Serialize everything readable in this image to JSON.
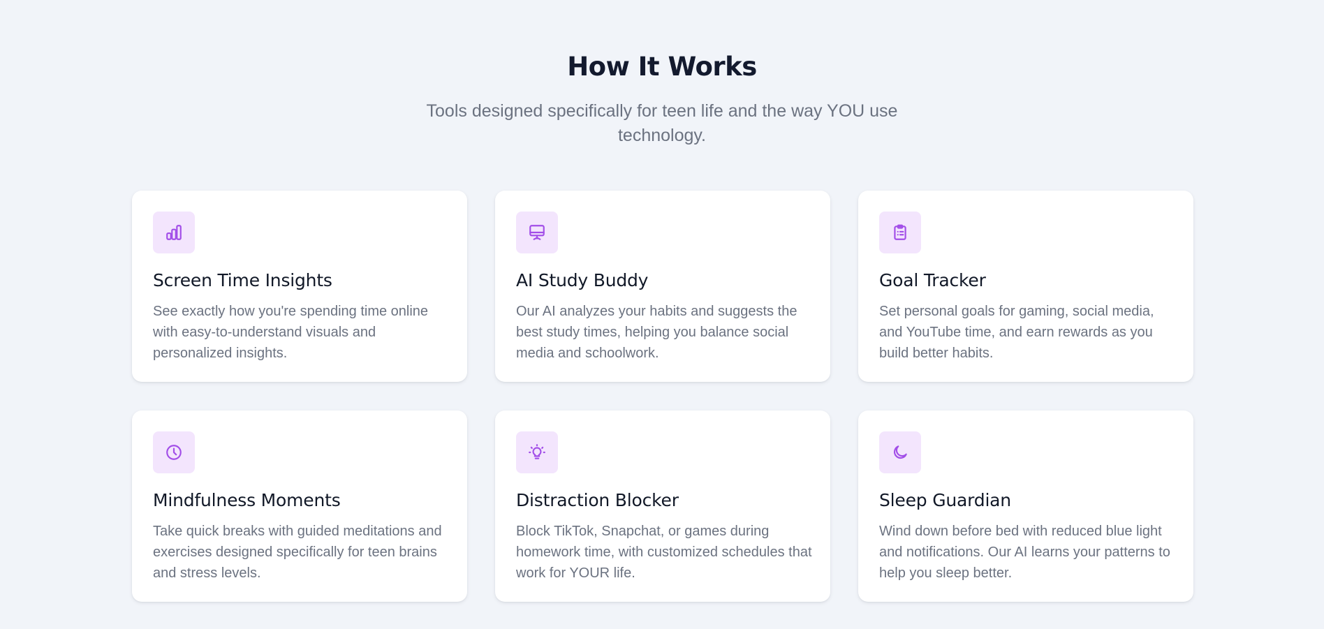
{
  "section": {
    "title": "How It Works",
    "subtitle": "Tools designed specifically for teen life and the way YOU use technology."
  },
  "features": [
    {
      "icon": "bar-chart-icon",
      "title": "Screen Time Insights",
      "description": "See exactly how you're spending time online with easy-to-understand visuals and personalized insights."
    },
    {
      "icon": "monitor-icon",
      "title": "AI Study Buddy",
      "description": "Our AI analyzes your habits and suggests the best study times, helping you balance social media and schoolwork."
    },
    {
      "icon": "clipboard-list-icon",
      "title": "Goal Tracker",
      "description": "Set personal goals for gaming, social media, and YouTube time, and earn rewards as you build better habits."
    },
    {
      "icon": "clock-icon",
      "title": "Mindfulness Moments",
      "description": "Take quick breaks with guided meditations and exercises designed specifically for teen brains and stress levels."
    },
    {
      "icon": "lightbulb-icon",
      "title": "Distraction Blocker",
      "description": "Block TikTok, Snapchat, or games during homework time, with customized schedules that work for YOUR life."
    },
    {
      "icon": "moon-icon",
      "title": "Sleep Guardian",
      "description": "Wind down before bed with reduced blue light and notifications. Our AI learns your patterns to help you sleep better."
    }
  ],
  "colors": {
    "page_background": "#f1f4f9",
    "card_background": "#ffffff",
    "icon_background": "#f3e5fd",
    "icon_accent": "#a24ee8",
    "heading": "#131a2e",
    "body_text": "#6b7280"
  }
}
